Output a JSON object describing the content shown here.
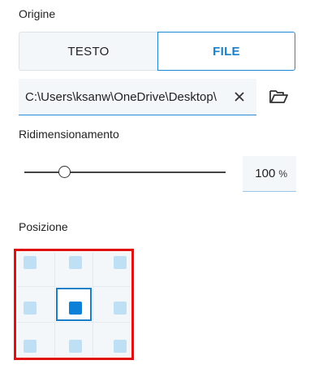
{
  "source": {
    "label": "Origine",
    "tabs": [
      {
        "label": "TESTO",
        "selected": false
      },
      {
        "label": "FILE",
        "selected": true
      }
    ],
    "file_path": "C:\\Users\\ksanw\\OneDrive\\Desktop\\"
  },
  "resize": {
    "label": "Ridimensionamento",
    "percent_value": "100",
    "unit": "%",
    "slider_fraction": 0.2
  },
  "position": {
    "label": "Posizione",
    "selected_cell": "center"
  },
  "icons": {
    "clear": "close-icon",
    "browse": "folder-open-icon"
  },
  "colors": {
    "accent": "#1a7fc9",
    "selected_square": "#0d80d8",
    "unselected_square": "#bfdff4",
    "highlight_frame": "#e01010"
  }
}
